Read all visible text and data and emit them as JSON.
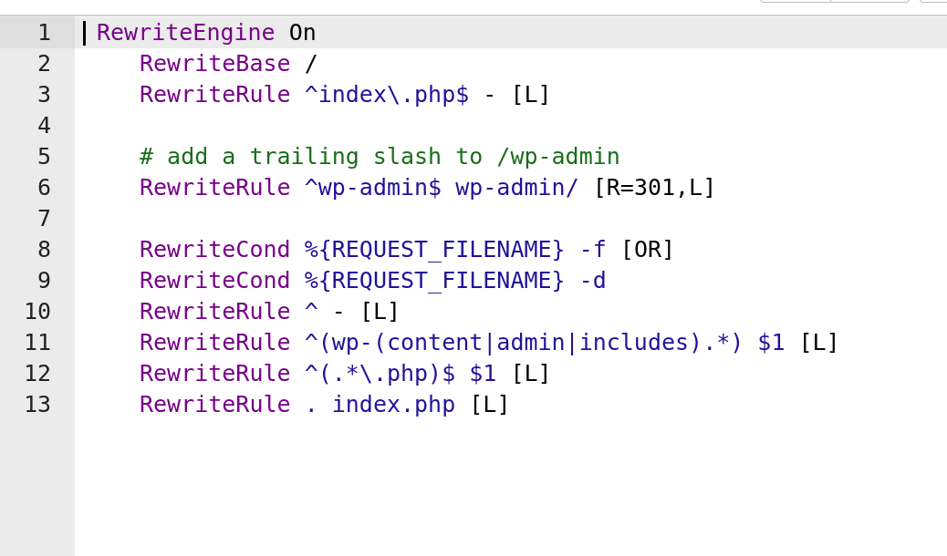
{
  "editor": {
    "lines": [
      {
        "number": "1",
        "active": true,
        "indented": false,
        "tokens": [
          {
            "kind": "keyword",
            "text": "RewriteEngine"
          },
          {
            "kind": "plain",
            "text": "On"
          }
        ]
      },
      {
        "number": "2",
        "active": false,
        "indented": true,
        "tokens": [
          {
            "kind": "keyword",
            "text": "RewriteBase"
          },
          {
            "kind": "plain",
            "text": "/"
          }
        ]
      },
      {
        "number": "3",
        "active": false,
        "indented": true,
        "tokens": [
          {
            "kind": "keyword",
            "text": "RewriteRule"
          },
          {
            "kind": "value",
            "text": "^index\\.php$"
          },
          {
            "kind": "plain",
            "text": "-"
          },
          {
            "kind": "plain",
            "text": "[L]"
          }
        ]
      },
      {
        "number": "4",
        "active": false
      },
      {
        "number": "5",
        "active": false,
        "indented": true,
        "tokens": [
          {
            "kind": "comment",
            "text": "# add a trailing slash to /wp-admin"
          }
        ]
      },
      {
        "number": "6",
        "active": false,
        "indented": true,
        "tokens": [
          {
            "kind": "keyword",
            "text": "RewriteRule"
          },
          {
            "kind": "value",
            "text": "^wp-admin$"
          },
          {
            "kind": "value",
            "text": "wp-admin/"
          },
          {
            "kind": "plain",
            "text": "[R=301,L]"
          }
        ]
      },
      {
        "number": "7",
        "active": false
      },
      {
        "number": "8",
        "active": false,
        "indented": true,
        "tokens": [
          {
            "kind": "keyword",
            "text": "RewriteCond"
          },
          {
            "kind": "value",
            "text": "%{REQUEST_FILENAME}"
          },
          {
            "kind": "value",
            "text": "-f"
          },
          {
            "kind": "plain",
            "text": "[OR]"
          }
        ]
      },
      {
        "number": "9",
        "active": false,
        "indented": true,
        "tokens": [
          {
            "kind": "keyword",
            "text": "RewriteCond"
          },
          {
            "kind": "value",
            "text": "%{REQUEST_FILENAME}"
          },
          {
            "kind": "value",
            "text": "-d"
          }
        ]
      },
      {
        "number": "10",
        "active": false,
        "indented": true,
        "tokens": [
          {
            "kind": "keyword",
            "text": "RewriteRule"
          },
          {
            "kind": "value",
            "text": "^"
          },
          {
            "kind": "plain",
            "text": "-"
          },
          {
            "kind": "plain",
            "text": "[L]"
          }
        ]
      },
      {
        "number": "11",
        "active": false,
        "indented": true,
        "tokens": [
          {
            "kind": "keyword",
            "text": "RewriteRule"
          },
          {
            "kind": "value",
            "text": "^(wp-(content|admin|includes).*)"
          },
          {
            "kind": "value",
            "text": "$1"
          },
          {
            "kind": "plain",
            "text": "[L]"
          }
        ]
      },
      {
        "number": "12",
        "active": false,
        "indented": true,
        "tokens": [
          {
            "kind": "keyword",
            "text": "RewriteRule"
          },
          {
            "kind": "value",
            "text": "^(.*\\.php)$"
          },
          {
            "kind": "value",
            "text": "$1"
          },
          {
            "kind": "plain",
            "text": "[L]"
          }
        ]
      },
      {
        "number": "13",
        "active": false,
        "indented": true,
        "tokens": [
          {
            "kind": "keyword",
            "text": "RewriteRule"
          },
          {
            "kind": "value",
            "text": "."
          },
          {
            "kind": "value",
            "text": "index.php"
          },
          {
            "kind": "plain",
            "text": "[L]"
          }
        ]
      }
    ]
  }
}
